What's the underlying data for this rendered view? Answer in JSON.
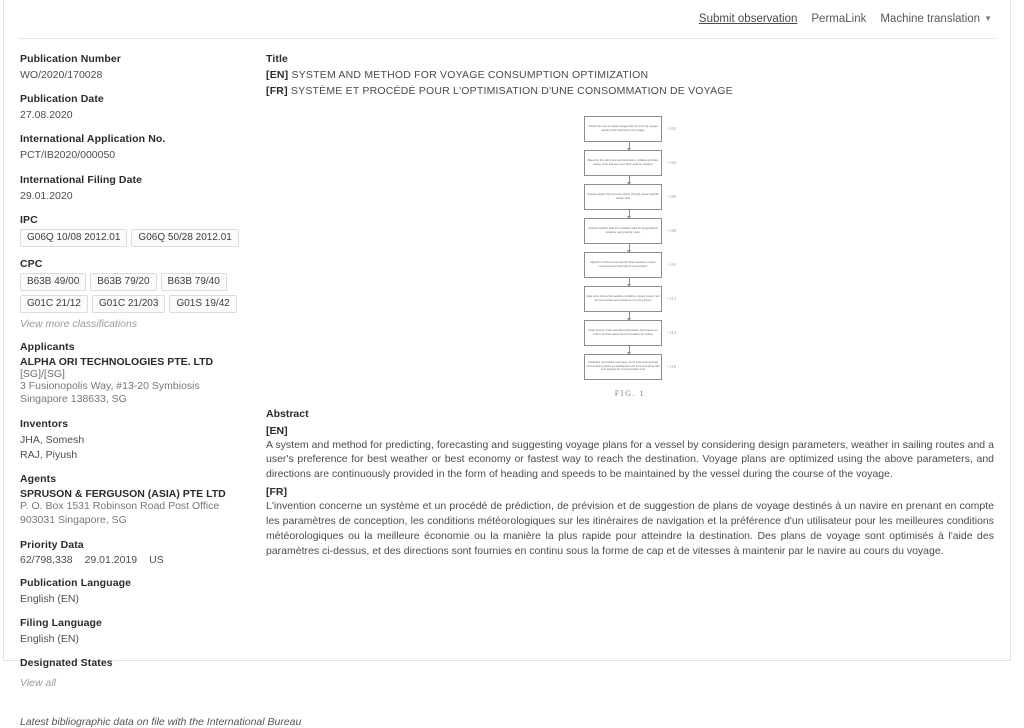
{
  "topbar": {
    "submit_observation": "Submit observation",
    "permalink": "PermaLink",
    "machine_translation": "Machine translation",
    "caret": "▼"
  },
  "left": {
    "publication_number_label": "Publication Number",
    "publication_number": "WO/2020/170028",
    "publication_date_label": "Publication Date",
    "publication_date": "27.08.2020",
    "intl_application_label": "International Application No.",
    "intl_application": "PCT/IB2020/000050",
    "intl_filing_date_label": "International Filing Date",
    "intl_filing_date": "29.01.2020",
    "ipc_label": "IPC",
    "ipc": [
      "G06Q 10/08 2012.01",
      "G06Q 50/28 2012.01"
    ],
    "cpc_label": "CPC",
    "cpc": [
      "B63B 49/00",
      "B63B 79/20",
      "B63B 79/40",
      "G01C 21/12",
      "G01C 21/203",
      "G01S 19/42"
    ],
    "view_more_classifications": "View more classifications",
    "applicants_label": "Applicants",
    "applicant_name": "ALPHA ORI TECHNOLOGIES PTE. LTD",
    "applicant_cc": "[SG]/[SG]",
    "applicant_addr1": "3 Fusionopolis Way, #13-20 Symbiosis",
    "applicant_addr2": "Singapore 138633, SG",
    "inventors_label": "Inventors",
    "inventors": [
      "JHA, Somesh",
      "RAJ, Piyush"
    ],
    "agents_label": "Agents",
    "agent_name": "SPRUSON & FERGUSON (ASIA) PTE LTD",
    "agent_addr1": "P. O. Box 1531 Robinson Road Post Office",
    "agent_addr2": "903031 Singapore, SG",
    "priority_label": "Priority Data",
    "priority_number": "62/798,338",
    "priority_date": "29.01.2019",
    "priority_country": "US",
    "publication_language_label": "Publication Language",
    "publication_language": "English (EN)",
    "filing_language_label": "Filing Language",
    "filing_language": "English (EN)",
    "designated_states_label": "Designated States",
    "view_all": "View all"
  },
  "title": {
    "label": "Title",
    "en_tag": "[EN]",
    "en": "SYSTEM AND METHOD FOR VOYAGE CONSUMPTION OPTIMIZATION",
    "fr_tag": "[FR]",
    "fr": "SYSTÈME ET PROCÉDÉ POUR L'OPTIMISATION D'UNE CONSOMMATION DE VOYAGE"
  },
  "figure": {
    "caption": "FIG. 1",
    "steps": [
      {
        "text": "Allows the user to create voyage plan by entering voyage details at the beginning of a voyage",
        "num": "102"
      },
      {
        "text": "Based on the start point and destination, software provides sailing route that are most often used by captains",
        "num": "104"
      },
      {
        "text": "Acquire design fuel oil consumption through vessel specific design data",
        "num": "106"
      },
      {
        "text": "Acquire weather data from weather sites for geographical locations along sailing routes",
        "num": "108"
      },
      {
        "text": "Algorithm to find vessel specific total resistance, power consumed and total fuel oil consumption",
        "num": "110"
      },
      {
        "text": "Data set is formed for weather conditions, speed, power, fuel oil consumption and resistance for every known",
        "num": "112"
      },
      {
        "text": "Data science model and data optimization techniques are built to provide speed recommendation for sailing",
        "num": "114"
      },
      {
        "text": "Predicted, forecasted, best case, worst case and reported consumption graphs are displayed in the front end along with cost savings for recommended route",
        "num": "116"
      }
    ]
  },
  "abstract": {
    "label": "Abstract",
    "en_tag": "[EN]",
    "en": "A system and method for predicting, forecasting and suggesting voyage plans for a vessel by considering design parameters, weather in sailing routes and a user's preference for best weather or best economy or fastest way to reach the destination. Voyage plans are optimized using the above parameters, and directions are continuously provided in the form of heading and speeds to be maintained by the vessel during the course of the voyage.",
    "fr_tag": "[FR]",
    "fr": "L'invention concerne un système et un procédé de prédiction, de prévision et de suggestion de plans de voyage destinés à un navire en prenant en compte les paramètres de conception, les conditions météorologiques sur les itinéraires de navigation et la préférence d'un utilisateur pour les meilleures conditions météorologiques ou la meilleure économie ou la manière la plus rapide pour atteindre la destination. Des plans de voyage sont optimisés à l'aide des paramètres ci-dessus, et des directions sont fournies en continu sous la forme de cap et de vitesses à maintenir par le navire au cours du voyage."
  },
  "footer": {
    "note": "Latest bibliographic data on file with the International Bureau"
  }
}
